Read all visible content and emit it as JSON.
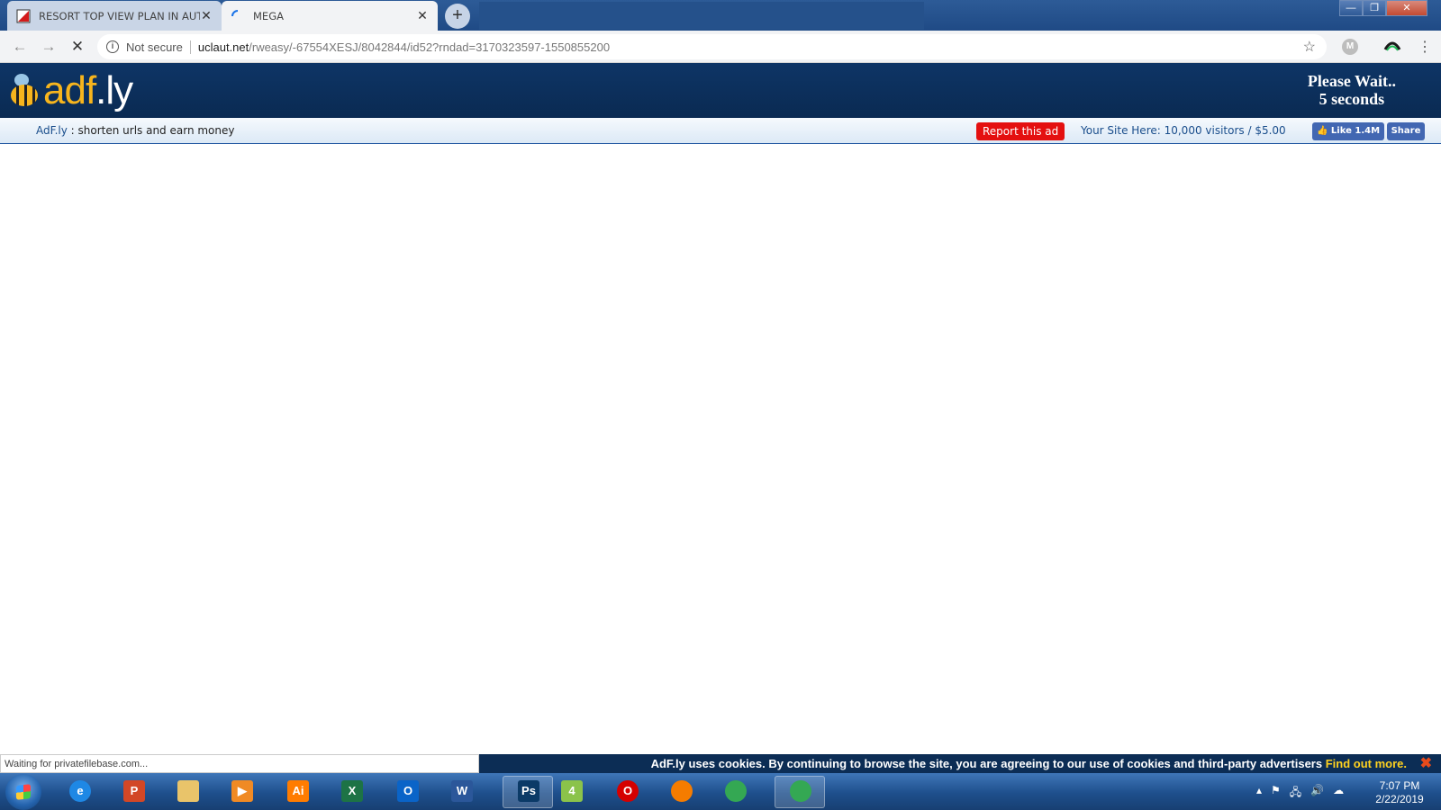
{
  "browser": {
    "tabs": [
      {
        "title": "RESORT TOP VIEW PLAN IN AUTO",
        "favicon": "autocad-favicon-icon",
        "active": false
      },
      {
        "title": "MEGA",
        "favicon": "loading-spinner-icon",
        "active": true
      }
    ],
    "new_tab_label": "+",
    "window_controls": {
      "minimize": "—",
      "maximize": "❐",
      "close": "✕"
    },
    "security_label": "Not secure",
    "url_host": "uclaut.net",
    "url_path": "/rweasy/-67554XESJ/8042844/id52?rndad=3170323597-1550855200",
    "status_text": "Waiting for privatefilebase.com...",
    "extension_label": "M"
  },
  "adfly": {
    "logo_prefix": "adf",
    "logo_suffix": ".ly",
    "wait_line1": "Please Wait..",
    "wait_line2": "5 seconds",
    "brand_link": "AdF.ly",
    "tagline": " : shorten urls and earn money",
    "report_button": "Report this ad",
    "your_site": "Your Site Here: 10,000 visitors / $5.00",
    "fb_like": "👍 Like 1.4M",
    "fb_share": "Share",
    "cookie_text": "AdF.ly uses cookies. By continuing to browse the site, you are agreeing to our use of cookies and third-party advertisers ",
    "cookie_link": "Find out more.",
    "cookie_close": "✖"
  },
  "taskbar": {
    "apps": [
      {
        "name": "internet-explorer",
        "glyph": "e",
        "color": "#1e88e5"
      },
      {
        "name": "powerpoint",
        "glyph": "P",
        "color": "#d24726"
      },
      {
        "name": "file-explorer",
        "glyph": "",
        "color": "#e9c46a"
      },
      {
        "name": "media-player",
        "glyph": "▶",
        "color": "#f08a24"
      },
      {
        "name": "illustrator",
        "glyph": "Ai",
        "color": "#ff7c00"
      },
      {
        "name": "excel",
        "glyph": "X",
        "color": "#1d7345"
      },
      {
        "name": "outlook",
        "glyph": "O",
        "color": "#0a64c8"
      },
      {
        "name": "word",
        "glyph": "W",
        "color": "#2b579a"
      },
      {
        "name": "photoshop",
        "glyph": "Ps",
        "color": "#0b3a67"
      },
      {
        "name": "app-4",
        "glyph": "4",
        "color": "#8bc34a"
      },
      {
        "name": "opera",
        "glyph": "O",
        "color": "#d50000"
      },
      {
        "name": "firefox",
        "glyph": "",
        "color": "#f57c00"
      },
      {
        "name": "chrome",
        "glyph": "",
        "color": "#34a853"
      },
      {
        "name": "chrome-active",
        "glyph": "",
        "color": "#34a853"
      }
    ],
    "time": "7:07 PM",
    "date": "2/22/2019"
  }
}
